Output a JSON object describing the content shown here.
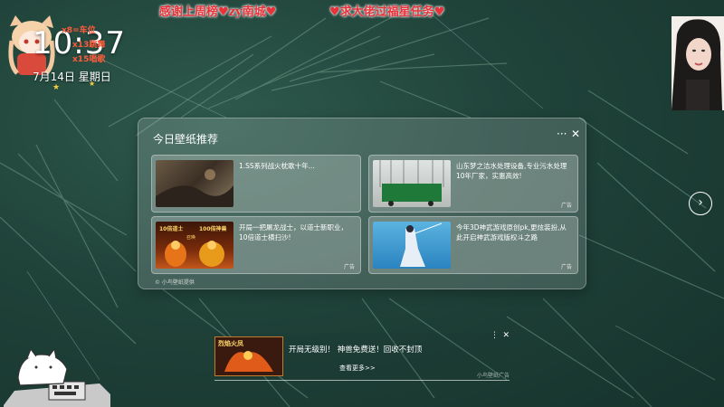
{
  "banner": {
    "left": "感谢上周榜♥zy南城♥",
    "right": "♥求大佬过福星任务♥"
  },
  "desktop": {
    "clock": "10:37",
    "date": "7月14日 星期日",
    "badges": [
      "x8=车位",
      "x13跳舞",
      "x15唱歌"
    ]
  },
  "panel": {
    "title": "今日壁纸推荐",
    "more_label": "···",
    "close_label": "✕",
    "cards": [
      {
        "text": "1.SS系列战火枕歌十年...",
        "ad": ""
      },
      {
        "text": "山东梦之洁水处理设备,专业污水处理10年厂家，实惠高效!",
        "ad": "广告"
      },
      {
        "text": "开局一把屠龙战士，以道士新职业，10倍道士横扫沙!",
        "ad": "广告",
        "thumb_a": "10倍道士",
        "thumb_b": "100倍神兽",
        "thumb_c": "召唤"
      },
      {
        "text": "今年3D神武游戏原创pk,更炫装扮,从此开启神武游戏版权斗之路",
        "ad": "广告"
      }
    ],
    "footer": "© 小鸟壁纸提供"
  },
  "next_label": "›",
  "adbar": {
    "text": "开局无级别！ 神兽免费送！回收不封顶",
    "more": "查看更多>>",
    "source": "小鸟壁纸广告",
    "img_label": "烈焰火凤",
    "close": "✕",
    "menu": "⋮"
  },
  "colors": {
    "banner": "#e8323a",
    "background": "#1f4239"
  }
}
